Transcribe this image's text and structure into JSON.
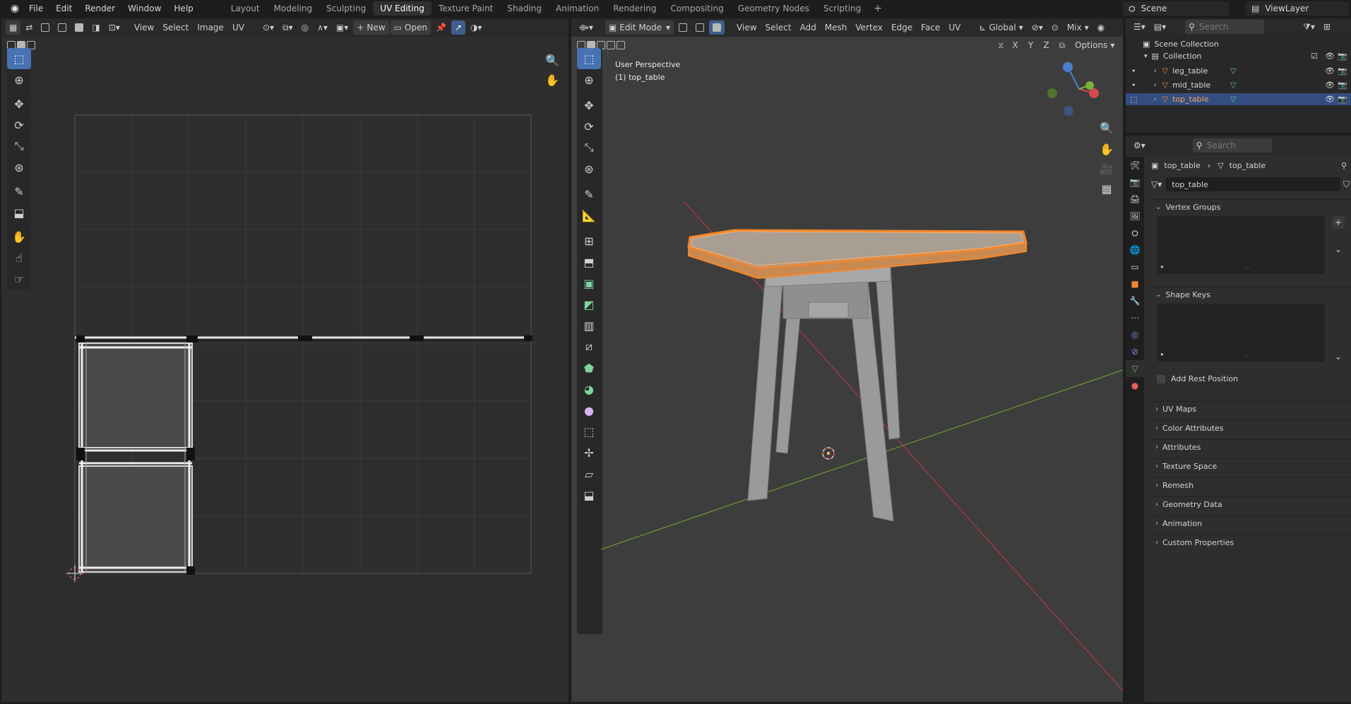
{
  "menu": [
    "File",
    "Edit",
    "Render",
    "Window",
    "Help"
  ],
  "workspaces": [
    "Layout",
    "Modeling",
    "Sculpting",
    "UV Editing",
    "Texture Paint",
    "Shading",
    "Animation",
    "Rendering",
    "Compositing",
    "Geometry Nodes",
    "Scripting"
  ],
  "active_workspace": "UV Editing",
  "add_workspace": "+",
  "scene": {
    "name": "Scene",
    "view_layer": "ViewLayer"
  },
  "uv_editor": {
    "menus": [
      "View",
      "Select",
      "Image",
      "UV"
    ],
    "new_label": "New",
    "open_label": "Open"
  },
  "viewport": {
    "mode": "Edit Mode",
    "menus": [
      "View",
      "Select",
      "Add",
      "Mesh",
      "Vertex",
      "Edge",
      "Face",
      "UV"
    ],
    "orientation": "Global",
    "snap": "Mix",
    "axes": [
      "X",
      "Y",
      "Z"
    ],
    "options": "Options",
    "overlay_title": "User Perspective",
    "overlay_object": "(1) top_table"
  },
  "outliner": {
    "search_placeholder": "Search",
    "scene_collection": "Scene Collection",
    "collection": "Collection",
    "objects": [
      "leg_table",
      "mid_table",
      "top_table"
    ],
    "selected": "top_table"
  },
  "properties": {
    "search_placeholder": "Search",
    "breadcrumb_object": "top_table",
    "breadcrumb_mesh": "top_table",
    "mesh_name": "top_table",
    "panels_open": [
      "Vertex Groups",
      "Shape Keys"
    ],
    "add_rest_position": "Add Rest Position",
    "panels_closed": [
      "UV Maps",
      "Color Attributes",
      "Attributes",
      "Texture Space",
      "Remesh",
      "Geometry Data",
      "Animation",
      "Custom Properties"
    ]
  },
  "colors": {
    "accent": "#4772b3",
    "selection_orange": "#f5862a",
    "x_axis": "#c0393f",
    "y_axis": "#6a9a2a"
  }
}
